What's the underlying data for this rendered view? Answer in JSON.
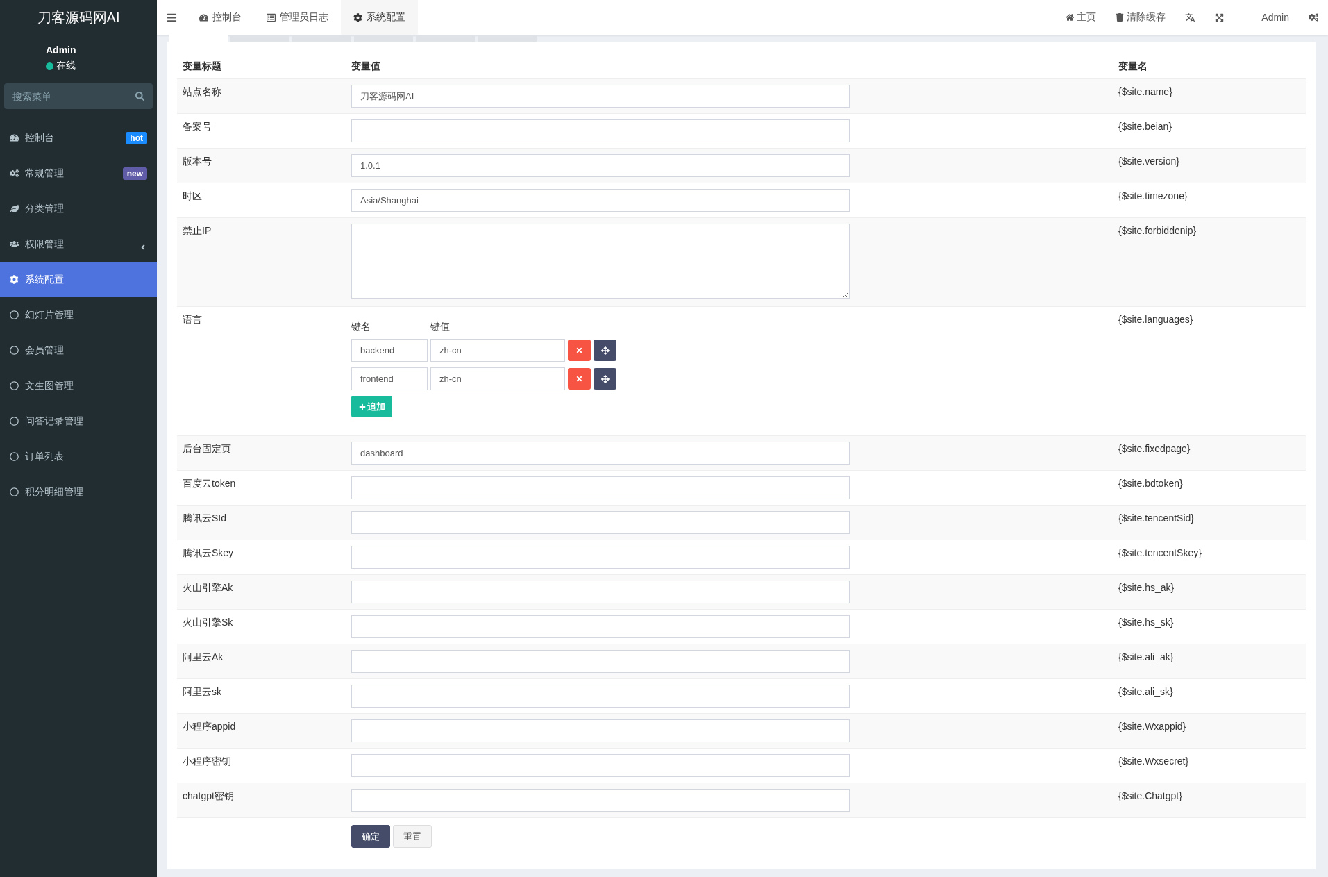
{
  "sidebar": {
    "logo": "刀客源码网AI",
    "user": {
      "name": "Admin",
      "status": "在线",
      "online": true
    },
    "search": {
      "placeholder": "搜索菜单"
    },
    "items": [
      {
        "label": "控制台",
        "badge": "hot",
        "color": "#1a8cff",
        "selected": false,
        "has_children": false
      },
      {
        "label": "常规管理",
        "badge": "new",
        "color": "#605ca8",
        "selected": false,
        "has_children": false
      },
      {
        "label": "分类管理",
        "selected": false,
        "has_children": false
      },
      {
        "label": "权限管理",
        "selected": false,
        "has_children": true
      },
      {
        "label": "系统配置",
        "selected": true,
        "has_children": false
      },
      {
        "label": "幻灯片管理",
        "selected": false,
        "has_children": false
      },
      {
        "label": "会员管理",
        "selected": false,
        "has_children": false
      },
      {
        "label": "文生图管理",
        "selected": false,
        "has_children": false
      },
      {
        "label": "问答记录管理",
        "selected": false,
        "has_children": false
      },
      {
        "label": "订单列表",
        "selected": false,
        "has_children": false
      },
      {
        "label": "积分明细管理",
        "selected": false,
        "has_children": false
      }
    ]
  },
  "topbar": {
    "tabs": [
      {
        "label": "控制台",
        "selected": false
      },
      {
        "label": "管理员日志",
        "selected": false
      },
      {
        "label": "系统配置",
        "selected": true
      }
    ],
    "actions": [
      {
        "label": "主页"
      },
      {
        "label": "清除缓存"
      }
    ],
    "user": "Admin"
  },
  "config_tabs": [
    {
      "selected": true
    },
    {
      "selected": false
    },
    {
      "selected": false
    },
    {
      "selected": false
    },
    {
      "selected": false
    },
    {
      "selected": false
    }
  ],
  "table": {
    "columns": [
      "变量标题",
      "变量值",
      "变量名"
    ],
    "rows": [
      {
        "kind": "text",
        "title": "站点名称",
        "value": "刀客源码网AI",
        "var": "{$site.name}"
      },
      {
        "kind": "text",
        "title": "备案号",
        "var": "{$site.beian}"
      },
      {
        "kind": "text",
        "title": "版本号",
        "value": "1.0.1",
        "var": "{$site.version}"
      },
      {
        "kind": "text",
        "title": "时区",
        "value": "Asia/Shanghai",
        "var": "{$site.timezone}"
      },
      {
        "kind": "textarea",
        "title": "禁止IP",
        "var": "{$site.forbiddenip}"
      },
      {
        "kind": "keyvalue",
        "title": "语言",
        "var": "{$site.languages}",
        "key_header": "键名",
        "value_header": "键值",
        "pairs": [
          {
            "key": "backend",
            "value": "zh-cn"
          },
          {
            "key": "frontend",
            "value": "zh-cn"
          }
        ],
        "add_label": "追加"
      },
      {
        "kind": "text",
        "title": "后台固定页",
        "value": "dashboard",
        "var": "{$site.fixedpage}"
      },
      {
        "kind": "text",
        "title": "百度云token",
        "var": "{$site.bdtoken}"
      },
      {
        "kind": "text",
        "title": "腾讯云SId",
        "var": "{$site.tencentSid}"
      },
      {
        "kind": "text",
        "title": "腾讯云Skey",
        "var": "{$site.tencentSkey}"
      },
      {
        "kind": "text",
        "title": "火山引擎Ak",
        "var": "{$site.hs_ak}"
      },
      {
        "kind": "text",
        "title": "火山引擎Sk",
        "var": "{$site.hs_sk}"
      },
      {
        "kind": "text",
        "title": "阿里云Ak",
        "var": "{$site.ali_ak}"
      },
      {
        "kind": "text",
        "title": "阿里云sk",
        "var": "{$site.ali_sk}"
      },
      {
        "kind": "text",
        "title": "小程序appid",
        "var": "{$site.Wxappid}"
      },
      {
        "kind": "text",
        "title": "小程序密钥",
        "var": "{$site.Wxsecret}"
      },
      {
        "kind": "text",
        "title": "chatgpt密钥",
        "var": "{$site.Chatgpt}"
      }
    ]
  },
  "buttons": [
    {
      "label": "确定",
      "kind": "primary"
    },
    {
      "label": "重置",
      "kind": "default"
    }
  ]
}
